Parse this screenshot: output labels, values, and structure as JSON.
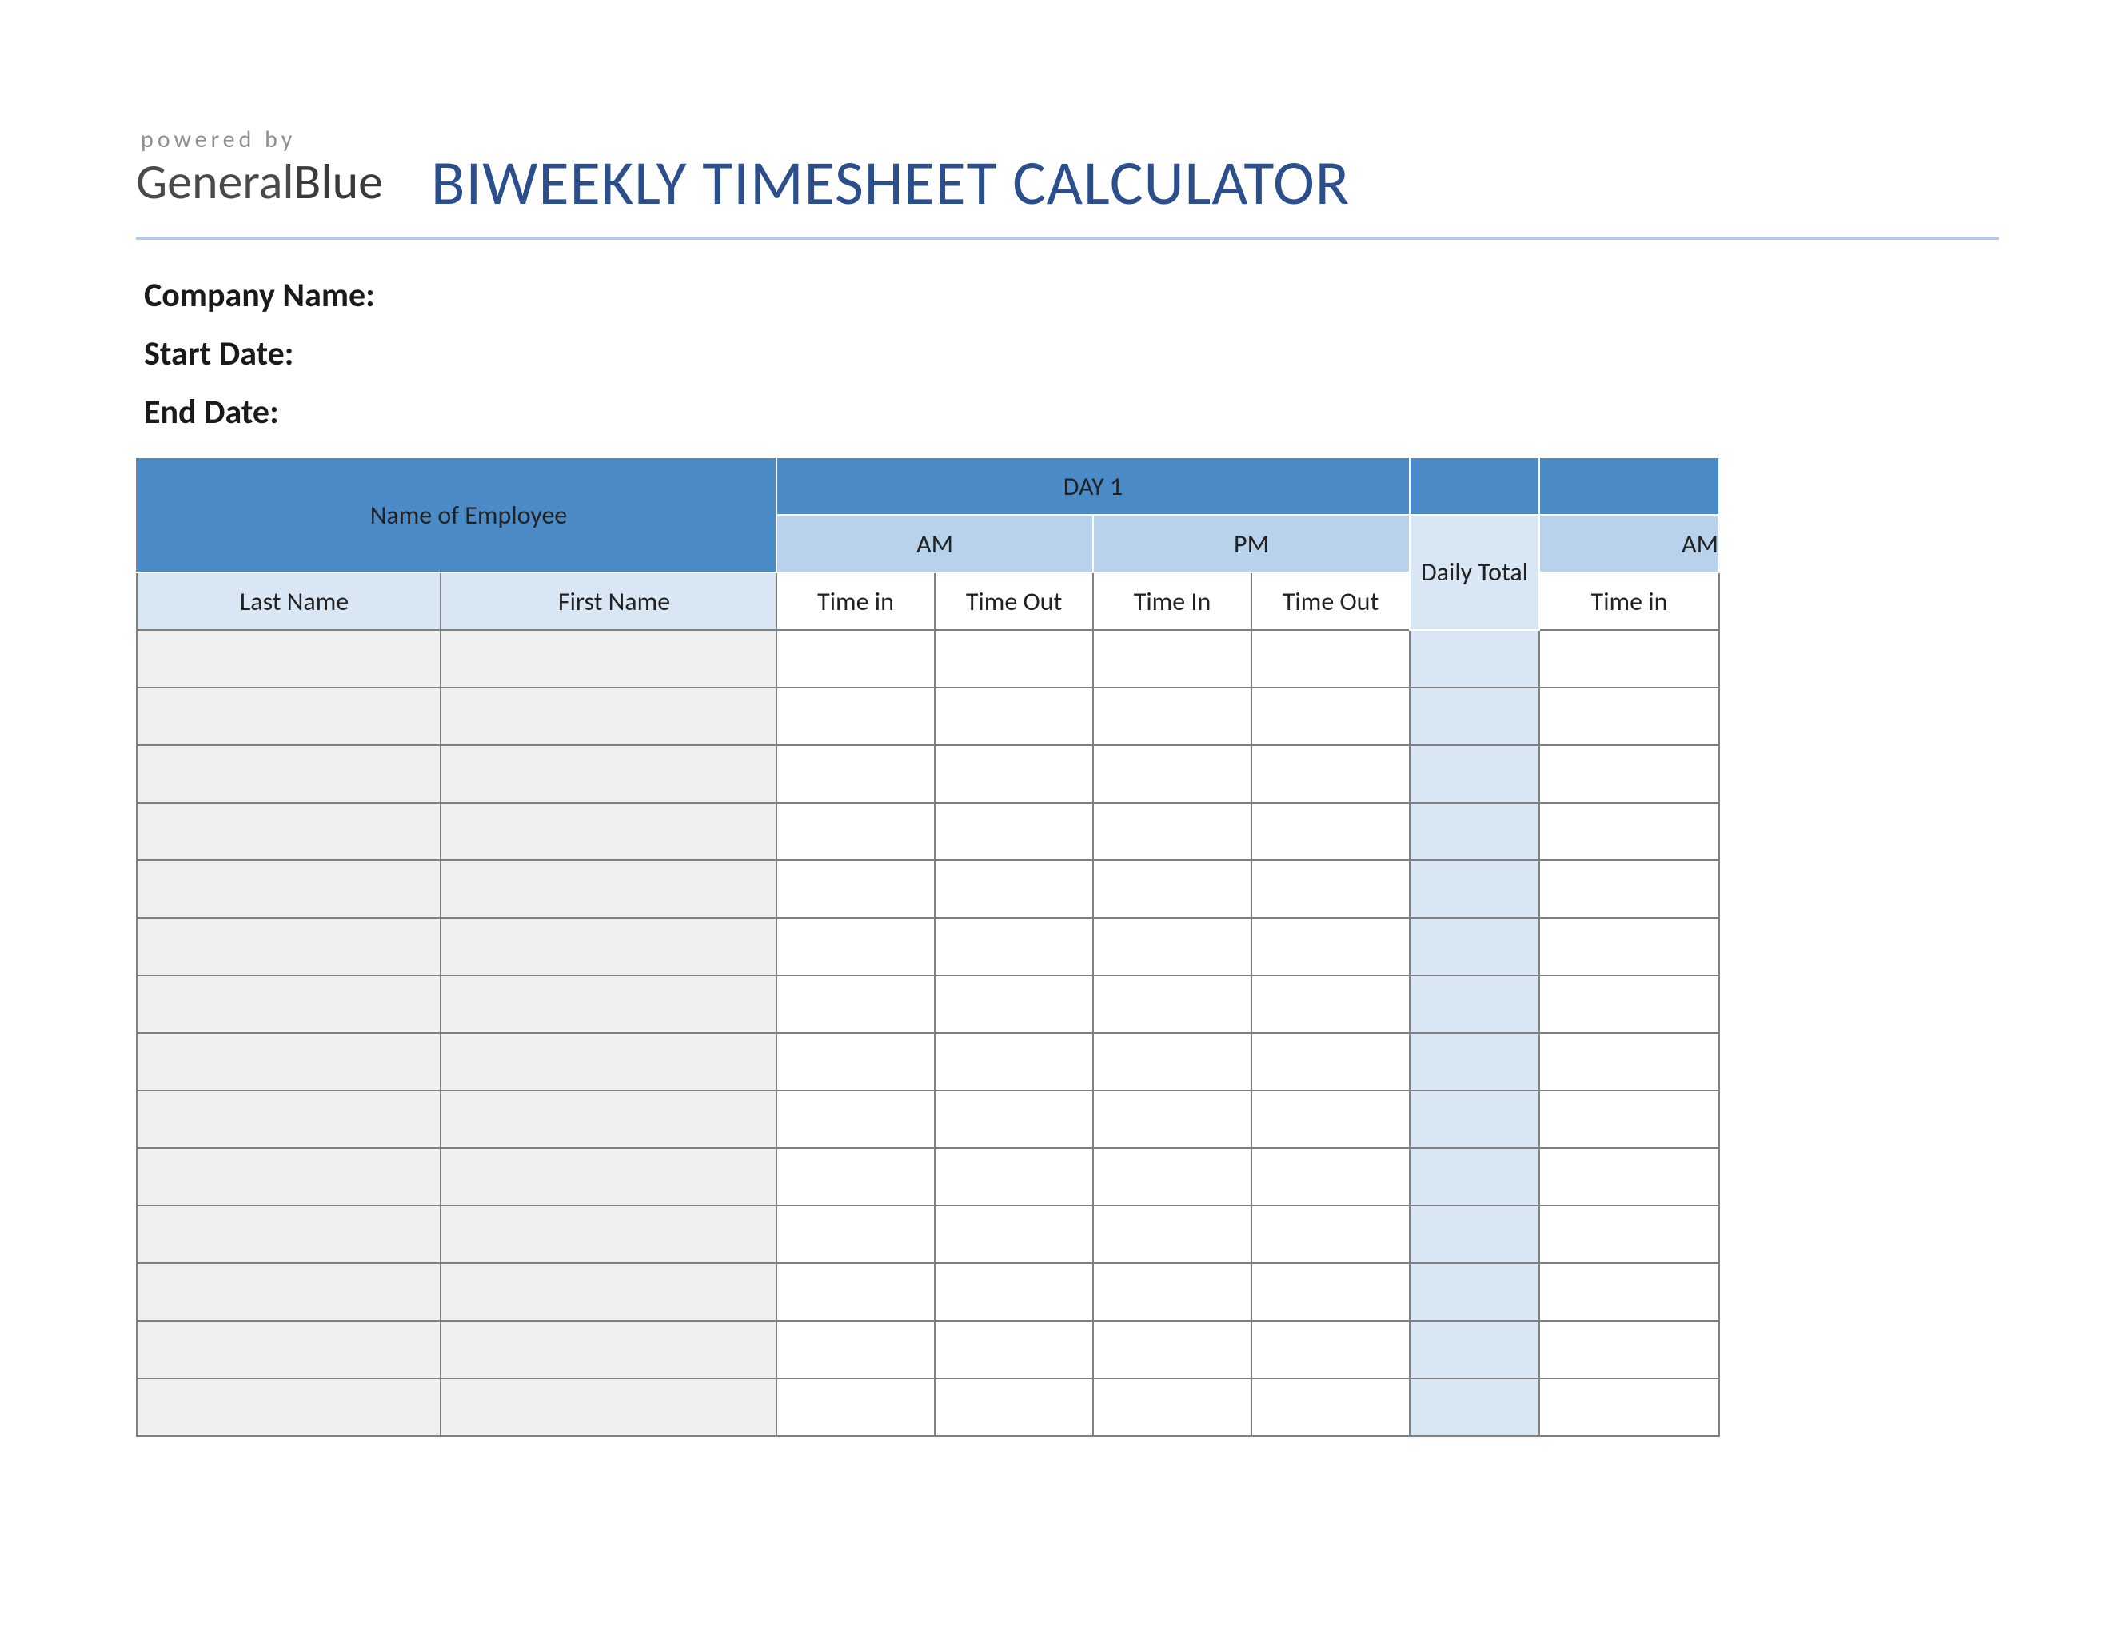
{
  "logo": {
    "powered_by": "powered by",
    "brand_part1": "General",
    "brand_part2": "Blue"
  },
  "title": "BIWEEKLY TIMESHEET CALCULATOR",
  "meta": {
    "company_label": "Company Name:",
    "start_date_label": "Start Date:",
    "end_date_label": "End Date:",
    "company_value": "",
    "start_date_value": "",
    "end_date_value": ""
  },
  "table": {
    "employee_header": "Name of Employee",
    "day1_header": "DAY 1",
    "day2_header": "",
    "am_label": "AM",
    "pm_label": "PM",
    "am2_label": "AM",
    "daily_total_label": "Daily Total",
    "last_name_label": "Last Name",
    "first_name_label": "First Name",
    "time_in_label": "Time in",
    "time_out_label": "Time Out",
    "time_in_label2": "Time In",
    "row_count": 14
  },
  "colors": {
    "primary_blue": "#4a8bc8",
    "light_blue": "#b8d2ec",
    "pale_blue": "#d9e6f4",
    "title_color": "#2a4f8c",
    "divider_color": "#b4c8e6"
  }
}
